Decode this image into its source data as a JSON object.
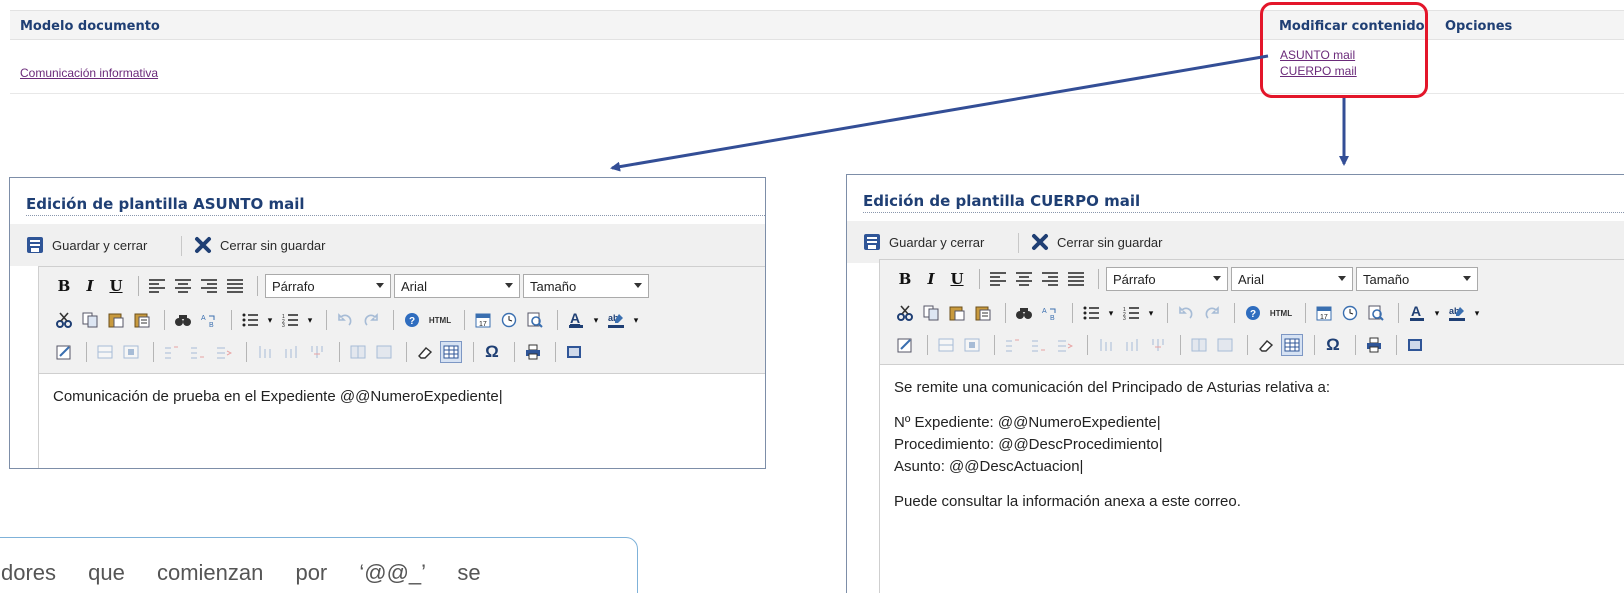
{
  "top": {
    "header_left": "Modelo documento",
    "header_modify": "Modificar contenido",
    "header_options": "Opciones",
    "doc_link": "Comunicación informativa",
    "link_subject": "ASUNTO mail",
    "link_body": "CUERPO mail",
    "highlight_color": "#e3162a"
  },
  "editor_actions": {
    "save_close": "Guardar y cerrar",
    "close_nosave": "Cerrar sin guardar"
  },
  "toolbar": {
    "paragraph_select": "Párrafo",
    "font_select": "Arial",
    "size_select": "Tamaño",
    "html_label": "HTML"
  },
  "subject_editor": {
    "title": "Edición de plantilla ASUNTO mail",
    "content_line": "Comunicación de prueba en el Expediente @@NumeroExpediente|"
  },
  "body_editor": {
    "title": "Edición de plantilla CUERPO mail",
    "lines": [
      "Se remite una comunicación del Principado de Asturias relativa a:",
      "Nº Expediente: @@NumeroExpediente|",
      "Procedimiento: @@DescProcedimiento|",
      "Asunto: @@DescActuacion|",
      "Puede consultar la información anexa a este correo."
    ]
  },
  "note": {
    "text": "dores que comienzan por ‘@@_’ se"
  },
  "colors": {
    "title_blue": "#1f3f74",
    "arrow_blue": "#334e96",
    "link_purple": "#6b2a7a"
  }
}
